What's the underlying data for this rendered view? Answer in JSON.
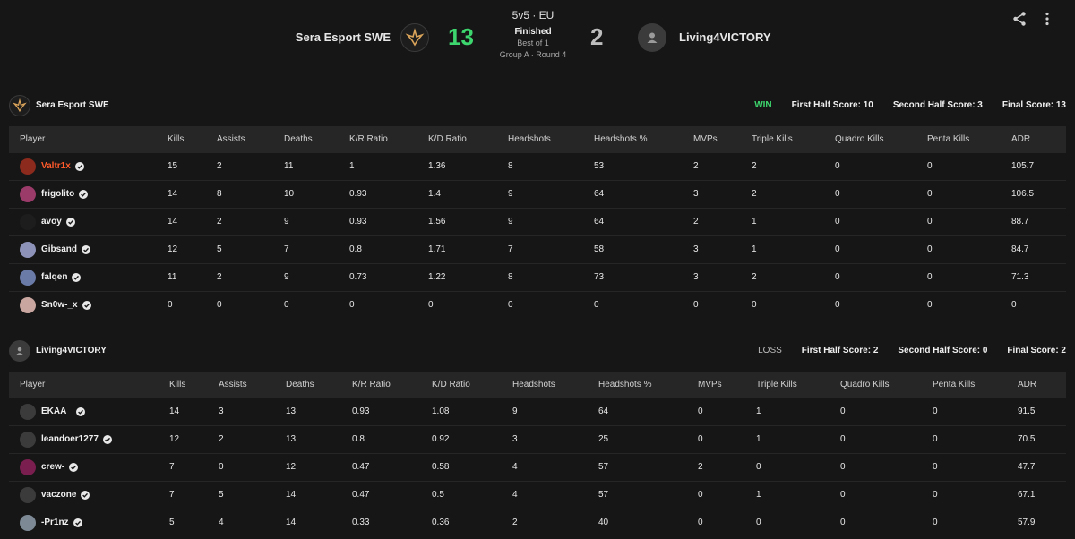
{
  "match": {
    "mode": "5v5 · EU",
    "status": "Finished",
    "best_of": "Best of 1",
    "group_round": "Group A · Round 4"
  },
  "team1": {
    "name": "Sera Esport SWE",
    "score": "13",
    "result": "WIN",
    "first_half": "First Half Score: 10",
    "second_half": "Second Half Score: 3",
    "final": "Final Score: 13",
    "players": [
      {
        "name": "Valtr1x",
        "highlight": true,
        "avatar": "#8b2a1d",
        "stats": [
          "15",
          "2",
          "11",
          "1",
          "1.36",
          "8",
          "53",
          "2",
          "2",
          "0",
          "0",
          "105.7"
        ]
      },
      {
        "name": "frigolito",
        "highlight": false,
        "avatar": "#9a3b6a",
        "stats": [
          "14",
          "8",
          "10",
          "0.93",
          "1.4",
          "9",
          "64",
          "3",
          "2",
          "0",
          "0",
          "106.5"
        ]
      },
      {
        "name": "avoy",
        "highlight": false,
        "avatar": "#1d1d1d",
        "stats": [
          "14",
          "2",
          "9",
          "0.93",
          "1.56",
          "9",
          "64",
          "2",
          "1",
          "0",
          "0",
          "88.7"
        ]
      },
      {
        "name": "Gibsand",
        "highlight": false,
        "avatar": "#8d92b8",
        "stats": [
          "12",
          "5",
          "7",
          "0.8",
          "1.71",
          "7",
          "58",
          "3",
          "1",
          "0",
          "0",
          "84.7"
        ]
      },
      {
        "name": "falqen",
        "highlight": false,
        "avatar": "#6b7ba8",
        "stats": [
          "11",
          "2",
          "9",
          "0.73",
          "1.22",
          "8",
          "73",
          "3",
          "2",
          "0",
          "0",
          "71.3"
        ]
      },
      {
        "name": "Sn0w-_x",
        "highlight": false,
        "avatar": "#c9a6a0",
        "stats": [
          "0",
          "0",
          "0",
          "0",
          "0",
          "0",
          "0",
          "0",
          "0",
          "0",
          "0",
          "0"
        ]
      }
    ]
  },
  "team2": {
    "name": "Living4VICTORY",
    "score": "2",
    "result": "LOSS",
    "first_half": "First Half Score: 2",
    "second_half": "Second Half Score: 0",
    "final": "Final Score: 2",
    "players": [
      {
        "name": "EKAA_",
        "highlight": false,
        "avatar": "#3b3b3b",
        "stats": [
          "14",
          "3",
          "13",
          "0.93",
          "1.08",
          "9",
          "64",
          "0",
          "1",
          "0",
          "0",
          "91.5"
        ]
      },
      {
        "name": "leandoer1277",
        "highlight": false,
        "avatar": "#3b3b3b",
        "stats": [
          "12",
          "2",
          "13",
          "0.8",
          "0.92",
          "3",
          "25",
          "0",
          "1",
          "0",
          "0",
          "70.5"
        ]
      },
      {
        "name": "crew-",
        "highlight": false,
        "avatar": "#7a1e4f",
        "stats": [
          "7",
          "0",
          "12",
          "0.47",
          "0.58",
          "4",
          "57",
          "2",
          "0",
          "0",
          "0",
          "47.7"
        ]
      },
      {
        "name": "vaczone",
        "highlight": false,
        "avatar": "#3b3b3b",
        "stats": [
          "7",
          "5",
          "14",
          "0.47",
          "0.5",
          "4",
          "57",
          "0",
          "1",
          "0",
          "0",
          "67.1"
        ]
      },
      {
        "name": "-Pr1nz",
        "highlight": false,
        "avatar": "#7d8a96",
        "stats": [
          "5",
          "4",
          "14",
          "0.33",
          "0.36",
          "2",
          "40",
          "0",
          "0",
          "0",
          "0",
          "57.9"
        ]
      }
    ]
  },
  "columns": [
    "Player",
    "Kills",
    "Assists",
    "Deaths",
    "K/R Ratio",
    "K/D Ratio",
    "Headshots",
    "Headshots %",
    "MVPs",
    "Triple Kills",
    "Quadro Kills",
    "Penta Kills",
    "ADR"
  ],
  "icons": {
    "share": "share-icon",
    "more": "more-vertical-icon",
    "verified": "verified-icon"
  },
  "colors": {
    "win": "#3dd56d",
    "highlight": "#ff5a2b",
    "header_bg": "#262626",
    "page_bg": "#161616"
  }
}
